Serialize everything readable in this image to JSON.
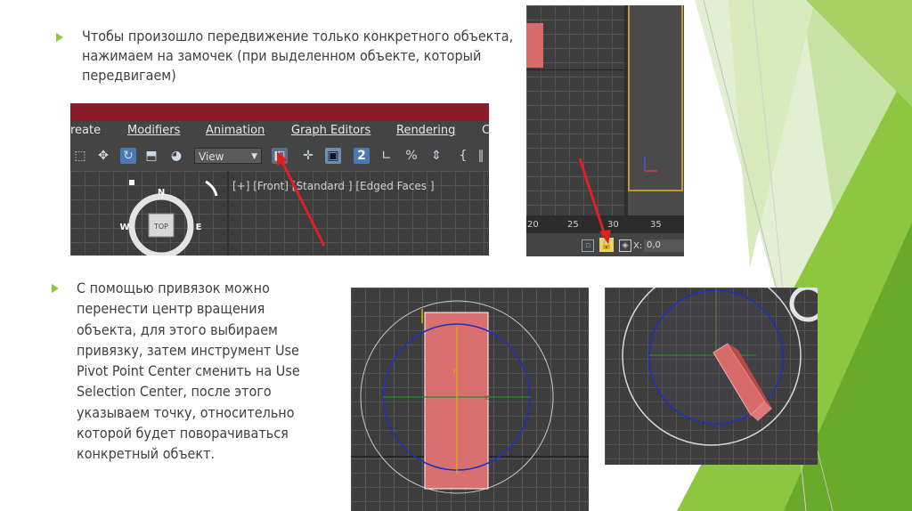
{
  "slide": {
    "bullet1": "Чтобы произошло передвижение только конкретного объекта, нажимаем на замочек (при выделенном объекте, который передвигаем)",
    "bullet2": "С помощью привязок можно перенести центр вращения объекта, для этого выбираем привязку, затем инструмент Use Pivot Point Center сменить на Use Selection Center, после этого указываем точку, относительно которой будет поворачиваться конкретный объект.",
    "accent_color": "#8dc63f"
  },
  "toolbar_shot": {
    "menu": [
      "reate",
      "Modifiers",
      "Animation",
      "Graph Editors",
      "Rendering",
      "C"
    ],
    "view_select": "View",
    "viewport_label": "[+] [Front] [Standard ] [Edged Faces ]",
    "viewcube": {
      "top": "TOP",
      "north": "N",
      "west": "W",
      "east": "E"
    }
  },
  "timeline_shot": {
    "ruler": [
      "20",
      "25",
      "30",
      "35"
    ],
    "x_label": "X:",
    "x_value": "0,0"
  }
}
